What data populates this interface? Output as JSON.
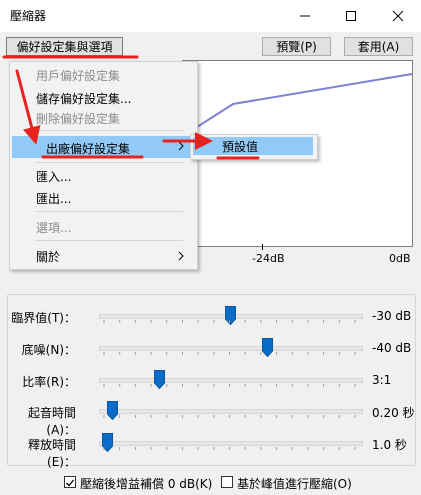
{
  "window": {
    "title": "壓縮器",
    "minimize_icon": "minimize-icon",
    "maximize_icon": "maximize-icon",
    "close_icon": "close-icon"
  },
  "toolbar": {
    "presets_label": "偏好設定集與選項",
    "preview_label": "預覽(P)",
    "apply_label": "套用(A)"
  },
  "graph": {
    "axis_labels": [
      "-24dB",
      "0dB"
    ]
  },
  "controls": [
    {
      "label": "臨界值(T)：",
      "value": "-30 dB",
      "level": 0.5
    },
    {
      "label": "底噪(N)：",
      "value": "-40 dB",
      "level": 0.65
    },
    {
      "label": "比率(R)：",
      "value": "3:1",
      "level": 0.22
    },
    {
      "label": "起音時間(A)：",
      "value": "0.20 秒",
      "level": 0.03
    },
    {
      "label": "釋放時間(E)：",
      "value": "1.0 秒",
      "level": 0.01
    }
  ],
  "options": {
    "makeup_gain_label": "壓縮後增益補償 0 dB(K)",
    "makeup_gain_checked": true,
    "peak_label": "基於峰值進行壓縮(O)",
    "peak_checked": false
  },
  "menu": {
    "items": [
      {
        "label": "用戶偏好設定集",
        "disabled": true
      },
      {
        "label": "儲存偏好設定集...",
        "disabled": false
      },
      {
        "label": "刪除偏好設定集",
        "disabled": true
      },
      {
        "label": "出廠偏好設定集",
        "disabled": false,
        "submenu": true
      },
      {
        "label": "匯入...",
        "disabled": false
      },
      {
        "label": "匯出...",
        "disabled": false
      },
      {
        "label": "選項...",
        "disabled": true
      },
      {
        "label": "關於",
        "disabled": false,
        "submenu": true
      }
    ],
    "submenu_item": "預設值"
  },
  "colors": {
    "accent_red": "#e8231f",
    "menu_highlight": "#91c9f7",
    "curve": "#7f7fd6",
    "thumb": "#0a6cc9"
  }
}
